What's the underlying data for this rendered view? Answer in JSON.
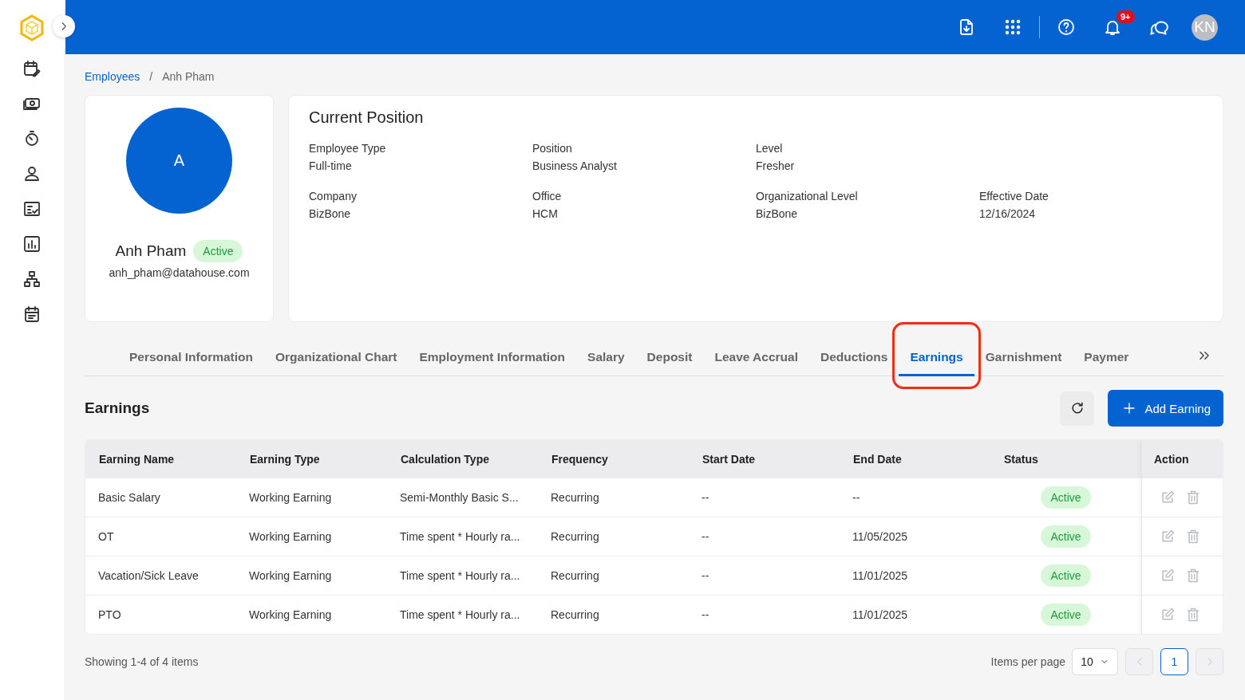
{
  "topbar": {
    "notification_badge": "9+",
    "user_initials": "KN"
  },
  "breadcrumb": {
    "items": [
      {
        "label": "Employees",
        "link": true
      },
      {
        "label": "Anh Pham",
        "link": false
      }
    ],
    "separator": "/"
  },
  "profile": {
    "avatar_letter": "A",
    "name": "Anh Pham",
    "status": "Active",
    "email": "anh_pham@datahouse.com"
  },
  "current_position": {
    "title": "Current Position",
    "rows": [
      [
        {
          "label": "Employee Type",
          "value": "Full-time"
        },
        {
          "label": "Position",
          "value": "Business Analyst"
        },
        {
          "label": "Level",
          "value": "Fresher"
        }
      ],
      [
        {
          "label": "Company",
          "value": "BizBone"
        },
        {
          "label": "Office",
          "value": "HCM"
        },
        {
          "label": "Organizational Level",
          "value": "BizBone"
        },
        {
          "label": "Effective Date",
          "value": "12/16/2024"
        }
      ]
    ]
  },
  "tabs": [
    {
      "label": "Personal Information",
      "selected": false,
      "highlighted": false
    },
    {
      "label": "Organizational Chart",
      "selected": false,
      "highlighted": false
    },
    {
      "label": "Employment Information",
      "selected": false,
      "highlighted": false
    },
    {
      "label": "Salary",
      "selected": false,
      "highlighted": false
    },
    {
      "label": "Deposit",
      "selected": false,
      "highlighted": false
    },
    {
      "label": "Leave Accrual",
      "selected": false,
      "highlighted": false
    },
    {
      "label": "Deductions",
      "selected": false,
      "highlighted": false
    },
    {
      "label": "Earnings",
      "selected": true,
      "highlighted": true
    },
    {
      "label": "Garnishment",
      "selected": false,
      "highlighted": false
    },
    {
      "label": "Paymer",
      "selected": false,
      "highlighted": false
    }
  ],
  "section": {
    "title": "Earnings",
    "add_button": "Add Earning"
  },
  "table": {
    "columns": [
      "Earning Name",
      "Earning Type",
      "Calculation Type",
      "Frequency",
      "Start Date",
      "End Date",
      "Status",
      "Action"
    ],
    "rows": [
      {
        "name": "Basic Salary",
        "type": "Working Earning",
        "calculation": "Semi-Monthly Basic S...",
        "frequency": "Recurring",
        "start": "--",
        "end": "--",
        "status": "Active"
      },
      {
        "name": "OT",
        "type": "Working Earning",
        "calculation": "Time spent * Hourly ra...",
        "frequency": "Recurring",
        "start": "--",
        "end": "11/05/2025",
        "status": "Active"
      },
      {
        "name": "Vacation/Sick Leave",
        "type": "Working Earning",
        "calculation": "Time spent * Hourly ra...",
        "frequency": "Recurring",
        "start": "--",
        "end": "11/01/2025",
        "status": "Active"
      },
      {
        "name": "PTO",
        "type": "Working Earning",
        "calculation": "Time spent * Hourly ra...",
        "frequency": "Recurring",
        "start": "--",
        "end": "11/01/2025",
        "status": "Active"
      }
    ]
  },
  "footer": {
    "summary": "Showing 1-4 of 4 items",
    "per_page_label": "Items per page",
    "per_page": "10",
    "pages": [
      {
        "label": "1",
        "selected": true
      }
    ]
  }
}
